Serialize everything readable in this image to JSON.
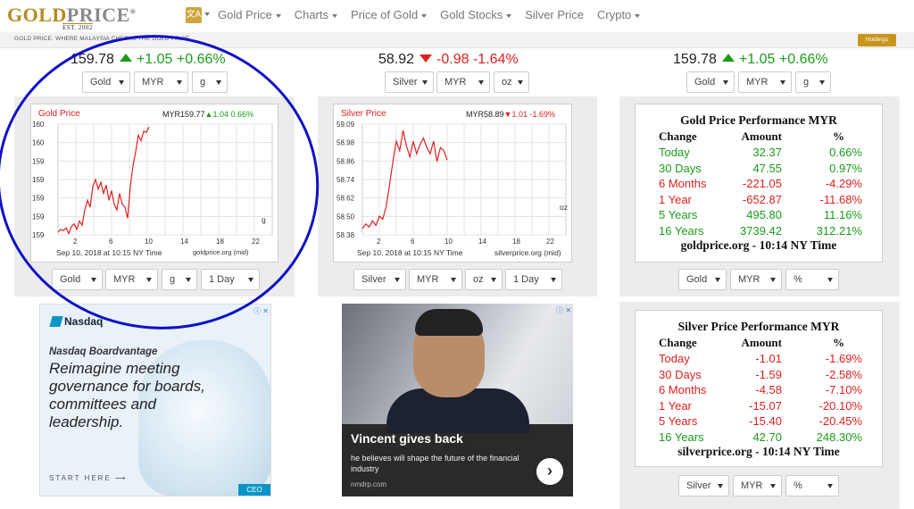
{
  "nav": {
    "logo_gold": "GOLD",
    "logo_price": "PRICE",
    "logo_reg": "®",
    "logo_est": "EST. 2002",
    "lang_icon": "文A",
    "items": [
      {
        "label": "Gold Price",
        "dropdown": true
      },
      {
        "label": "Charts",
        "dropdown": true
      },
      {
        "label": "Price of Gold",
        "dropdown": true
      },
      {
        "label": "Gold Stocks",
        "dropdown": true
      },
      {
        "label": "Silver Price",
        "dropdown": false
      },
      {
        "label": "Crypto",
        "dropdown": true
      }
    ]
  },
  "subbar": {
    "text": "GOLD PRICE. WHERE MALAYSIA CHECKS THE GOLD PRICE",
    "holdings_label": "Holdings"
  },
  "left": {
    "price": "159.78",
    "change": "+1.05",
    "percent": "+0.66%",
    "direction": "up",
    "selects": [
      "Gold",
      "MYR",
      "g"
    ],
    "chart": {
      "title": "Gold Price",
      "value": "MYR159.77",
      "change": "1.04",
      "percent": "0.66%",
      "direction": "up",
      "footer_date": "Sep 10, 2018 at 10:15 NY Time",
      "footer_src": "goldprice.org (mid)",
      "unit": "g"
    },
    "bottom_selects": [
      "Gold",
      "MYR",
      "g",
      "1 Day"
    ]
  },
  "middle": {
    "price": "58.92",
    "change": "-0.98",
    "percent": "-1.64%",
    "direction": "down",
    "selects": [
      "Silver",
      "MYR",
      "oz"
    ],
    "chart": {
      "title": "Silver Price",
      "value": "MYR58.89",
      "change": "1.01",
      "percent": "-1.69%",
      "direction": "down",
      "footer_date": "Sep 10, 2018 at 10:15 NY Time",
      "footer_src": "silverprice.org (mid)",
      "unit": "oz"
    },
    "bottom_selects": [
      "Silver",
      "MYR",
      "oz",
      "1 Day"
    ]
  },
  "right": {
    "price": "159.78",
    "change": "+1.05",
    "percent": "+0.66%",
    "direction": "up",
    "selects": [
      "Gold",
      "MYR",
      "g"
    ],
    "gold_perf": {
      "title": "Gold Price Performance MYR",
      "headers": [
        "Change",
        "Amount",
        "%"
      ],
      "rows": [
        {
          "label": "Today",
          "amount": "32.37",
          "pct": "0.66%",
          "color": "green"
        },
        {
          "label": "30 Days",
          "amount": "47.55",
          "pct": "0.97%",
          "color": "green"
        },
        {
          "label": "6 Months",
          "amount": "-221.05",
          "pct": "-4.29%",
          "color": "red"
        },
        {
          "label": "1 Year",
          "amount": "-652.87",
          "pct": "-11.68%",
          "color": "red"
        },
        {
          "label": "5 Years",
          "amount": "495.80",
          "pct": "11.16%",
          "color": "green"
        },
        {
          "label": "16 Years",
          "amount": "3739.42",
          "pct": "312.21%",
          "color": "green"
        }
      ],
      "footer": "goldprice.org - 10:14 NY Time"
    },
    "gold_perf_selects": [
      "Gold",
      "MYR",
      "%"
    ],
    "silver_perf": {
      "title": "Silver Price Performance MYR",
      "headers": [
        "Change",
        "Amount",
        "%"
      ],
      "rows": [
        {
          "label": "Today",
          "amount": "-1.01",
          "pct": "-1.69%",
          "color": "red"
        },
        {
          "label": "30 Days",
          "amount": "-1.59",
          "pct": "-2.58%",
          "color": "red"
        },
        {
          "label": "6 Months",
          "amount": "-4.58",
          "pct": "-7.10%",
          "color": "red"
        },
        {
          "label": "1 Year",
          "amount": "-15.07",
          "pct": "-20.10%",
          "color": "red"
        },
        {
          "label": "5 Years",
          "amount": "-15.40",
          "pct": "-20.45%",
          "color": "red"
        },
        {
          "label": "16 Years",
          "amount": "42.70",
          "pct": "248.30%",
          "color": "green"
        }
      ],
      "footer": "silverprice.org - 10:14 NY Time"
    },
    "silver_perf_selects": [
      "Silver",
      "MYR",
      "%"
    ]
  },
  "ads": {
    "nasdaq": {
      "logo": "Nasdaq",
      "sub": "Nasdaq Boardvantage",
      "main": "Reimagine meeting governance for boards, committees and leadership.",
      "cta": "START HERE ⟶",
      "badge": "CEO",
      "choices": "ⓘ ✕"
    },
    "vincent": {
      "title": "Vincent gives back",
      "text": "he believes will shape the future of the financial industry",
      "source": "nmdrp.com",
      "button": "›",
      "choices": "ⓘ ✕"
    }
  },
  "chart_data": [
    {
      "type": "line",
      "title": "Gold Price",
      "ylabels": [
        "160",
        "160",
        "159",
        "159",
        "159",
        "159",
        "159"
      ],
      "xlabels": [
        "2",
        "6",
        "10",
        "14",
        "18",
        "22"
      ],
      "x": [
        0.0,
        0.3,
        0.6,
        0.9,
        1.2,
        1.5,
        1.8,
        2.1,
        2.4,
        2.7,
        3.0,
        3.3,
        3.6,
        3.9,
        4.2,
        4.5,
        4.8,
        5.1,
        5.4,
        5.7,
        6.0,
        6.3,
        6.6,
        6.9,
        7.2,
        7.5,
        7.8,
        8.1,
        8.4,
        8.7,
        9.0,
        9.3,
        9.6,
        9.9,
        10.2
      ],
      "y": [
        159.02,
        159.04,
        159.03,
        159.05,
        159.01,
        159.06,
        159.08,
        159.04,
        159.1,
        159.07,
        159.18,
        159.25,
        159.2,
        159.35,
        159.4,
        159.33,
        159.38,
        159.3,
        159.36,
        159.25,
        159.32,
        159.22,
        159.18,
        159.3,
        159.22,
        159.2,
        159.12,
        159.35,
        159.5,
        159.6,
        159.72,
        159.68,
        159.75,
        159.74,
        159.78
      ],
      "ylim": [
        159.0,
        159.8
      ],
      "xlim": [
        0,
        24
      ]
    },
    {
      "type": "line",
      "title": "Silver Price",
      "ylabels": [
        "59.09",
        "58.98",
        "58.86",
        "58.74",
        "58.62",
        "58.50",
        "58.38"
      ],
      "xlabels": [
        "2",
        "6",
        "10",
        "14",
        "18",
        "22"
      ],
      "x": [
        0.0,
        0.4,
        0.8,
        1.2,
        1.6,
        2.0,
        2.4,
        2.8,
        3.2,
        3.6,
        4.0,
        4.4,
        4.8,
        5.2,
        5.6,
        6.0,
        6.4,
        6.8,
        7.2,
        7.6,
        8.0,
        8.4,
        8.8,
        9.2,
        9.6,
        10.0
      ],
      "y": [
        58.42,
        58.45,
        58.43,
        58.47,
        58.44,
        58.5,
        58.48,
        58.56,
        58.7,
        58.85,
        58.98,
        58.92,
        59.05,
        58.95,
        58.88,
        58.98,
        58.9,
        58.96,
        59.0,
        58.94,
        58.9,
        58.98,
        58.85,
        58.94,
        58.92,
        58.86
      ],
      "ylim": [
        58.38,
        59.09
      ],
      "xlim": [
        0,
        24
      ]
    }
  ]
}
